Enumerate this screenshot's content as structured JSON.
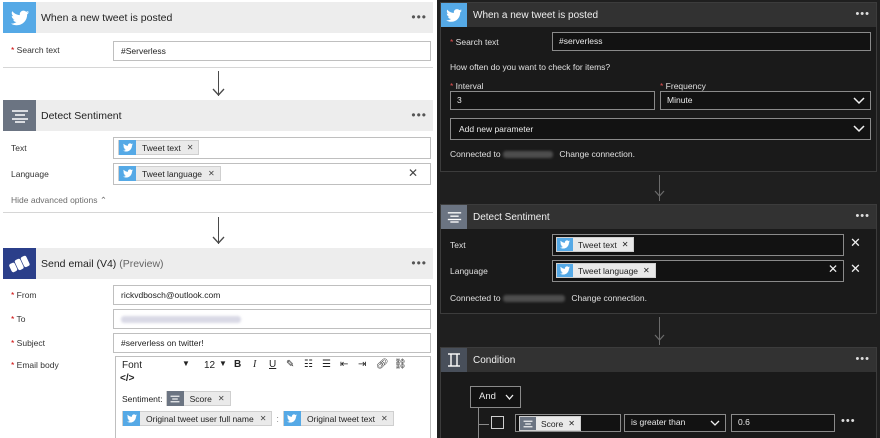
{
  "left": {
    "trigger": {
      "title": "When a new tweet is posted",
      "search_label": "Search text",
      "search_value": "#Serverless"
    },
    "sentiment": {
      "title": "Detect Sentiment",
      "text_label": "Text",
      "text_token": "Tweet text",
      "language_label": "Language",
      "language_token": "Tweet language",
      "hide_advanced": "Hide advanced options"
    },
    "email": {
      "title": "Send email (V4)",
      "title_suffix": "(Preview)",
      "from_label": "From",
      "from_value": "rickvdbosch@outlook.com",
      "to_label": "To",
      "subject_label": "Subject",
      "subject_value": "#serverless on twitter!",
      "body_label": "Email body",
      "font_label": "Font",
      "font_size": "12",
      "sentiment_text": "Sentiment:",
      "score_token": "Score",
      "user_token": "Original tweet user full name",
      "text_token": "Original tweet text"
    }
  },
  "right": {
    "trigger": {
      "title": "When a new tweet is posted",
      "search_label": "Search text",
      "search_value": "#serverless",
      "question": "How often do you want to check for items?",
      "interval_label": "Interval",
      "interval_value": "3",
      "frequency_label": "Frequency",
      "frequency_value": "Minute",
      "add_param": "Add new parameter",
      "connected_to": "Connected to",
      "change_connection": "Change connection."
    },
    "sentiment": {
      "title": "Detect Sentiment",
      "text_label": "Text",
      "text_token": "Tweet text",
      "language_label": "Language",
      "language_token": "Tweet language",
      "connected_to": "Connected to",
      "change_connection": "Change connection."
    },
    "condition": {
      "title": "Condition",
      "operator": "And",
      "score_token": "Score",
      "comparison": "is greater than",
      "value": "0.6"
    }
  },
  "colors": {
    "twitter": "#55a9e6",
    "sentiment": "#6b7482",
    "email": "#2b3f8a",
    "dark_bg": "#1f1f1f"
  }
}
